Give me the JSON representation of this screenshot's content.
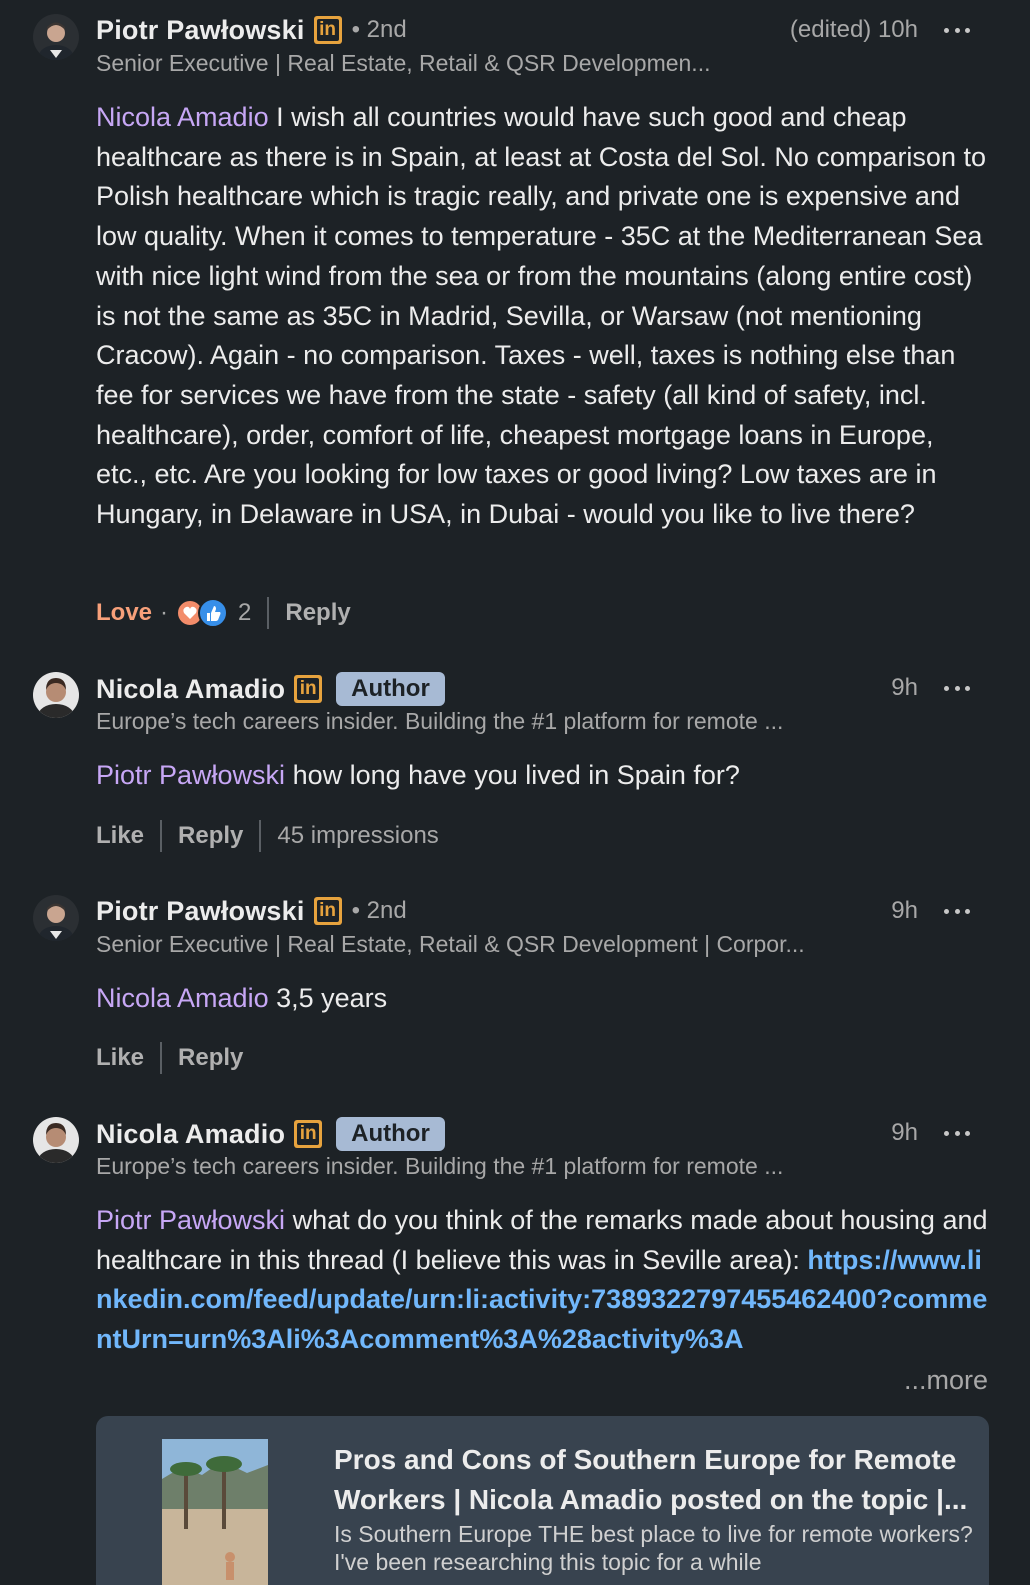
{
  "comments": [
    {
      "author": "Piotr Pawłowski",
      "degree": "• 2nd",
      "headline": "Senior Executive | Real Estate, Retail & QSR Developmen...",
      "time": "(edited) 10h",
      "mention": "Nicola Amadio",
      "text": " I wish all countries would have such good and cheap healthcare as there is in Spain, at least at Costa del Sol. No comparison to Polish healthcare which is tragic really, and private one is expensive and low quality. When it comes to temperature - 35C at the Mediterranean Sea with nice light wind from the sea or from the mountains (along entire cost) is not the same as 35C in Madrid, Sevilla, or Warsaw (not mentioning Cracow). Again - no comparison. Taxes - well, taxes is nothing else than fee for services we have from the state - safety (all kind of safety, incl. healthcare), order, comfort of life, cheapest mortgage loans in Europe, etc., etc. Are you looking for low taxes or good living? Low taxes are in Hungary, in Delaware in USA, in Dubai - would you like to live there?",
      "reaction_label": "Love",
      "reaction_count": "2",
      "reply_label": "Reply"
    },
    {
      "author": "Nicola Amadio",
      "tag": "Author",
      "headline": "Europe’s tech careers insider. Building the #1 platform for remote ...",
      "time": "9h",
      "mention": "Piotr Pawłowski",
      "text": " how long have you lived in Spain for?",
      "like_label": "Like",
      "reply_label": "Reply",
      "impressions": "45 impressions"
    },
    {
      "author": "Piotr Pawłowski",
      "degree": "• 2nd",
      "headline": "Senior Executive | Real Estate, Retail & QSR Development | Corpor...",
      "time": "9h",
      "mention": "Nicola Amadio",
      "text": " 3,5 years",
      "like_label": "Like",
      "reply_label": "Reply"
    },
    {
      "author": "Nicola Amadio",
      "tag": "Author",
      "headline": "Europe’s tech careers insider. Building the #1 platform for remote ...",
      "time": "9h",
      "mention": "Piotr Pawłowski",
      "text": " what do you think of the remarks made about housing and healthcare in this thread (I believe this was in Seville area): ",
      "link": "https://www.linkedin.com/feed/update/urn:li:activity:7389322797455462400?commentUrn=urn%3Ali%3Acomment%3A%28activity%3A",
      "more_label": "...more",
      "card": {
        "title": "Pros and Cons of Southern Europe for Remote Workers | Nicola Amadio posted on the topic |...",
        "description": "Is Southern Europe THE best place to live for remote workers? I've been researching this topic for a while"
      }
    }
  ],
  "icons": {
    "linkedin_badge": "in",
    "more_options": "more-options-icon",
    "reaction_love": "heart-reaction-icon",
    "reaction_like": "thumbs-up-reaction-icon"
  },
  "colors": {
    "background": "#1d2226",
    "mention": "#c7a7f5",
    "link": "#71b7fb",
    "love": "#f7a07a",
    "author_tag": "#a7bad4",
    "linkedin_badge": "#e7a33e"
  }
}
